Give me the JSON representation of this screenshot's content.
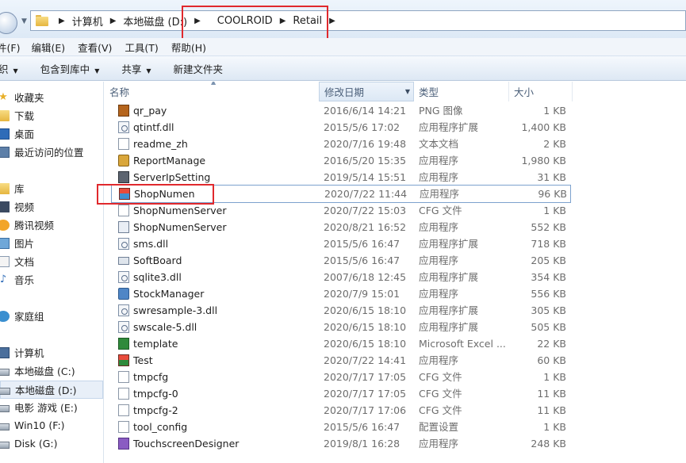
{
  "address_bar": {
    "breadcrumbs": [
      "计算机",
      "本地磁盘 (D:)",
      "COOLROID",
      "Retail"
    ]
  },
  "menubar": {
    "items": [
      "件(F)",
      "编辑(E)",
      "查看(V)",
      "工具(T)",
      "帮助(H)"
    ]
  },
  "toolbar": {
    "items": [
      "织",
      "包含到库中",
      "共享",
      "新建文件夹"
    ]
  },
  "navpane": {
    "items": [
      {
        "label": "收藏夹",
        "icon": "star-icon"
      },
      {
        "label": "下载",
        "icon": "folder-icon"
      },
      {
        "label": "桌面",
        "icon": "desktop-icon"
      },
      {
        "label": "最近访问的位置",
        "icon": "recent-icon"
      },
      {
        "label": "库",
        "icon": "library-icon"
      },
      {
        "label": "视频",
        "icon": "video-icon"
      },
      {
        "label": "腾讯视频",
        "icon": "qq-video-icon"
      },
      {
        "label": "图片",
        "icon": "picture-icon"
      },
      {
        "label": "文档",
        "icon": "document-icon"
      },
      {
        "label": "音乐",
        "icon": "music-icon"
      },
      {
        "label": "家庭组",
        "icon": "homegroup-icon"
      },
      {
        "label": "计算机",
        "icon": "computer-icon"
      },
      {
        "label": "本地磁盘 (C:)",
        "icon": "drive-icon"
      },
      {
        "label": "本地磁盘 (D:)",
        "icon": "drive-icon",
        "selected": true
      },
      {
        "label": "电影 游戏 (E:)",
        "icon": "drive-icon"
      },
      {
        "label": "Win10 (F:)",
        "icon": "drive-icon"
      },
      {
        "label": "Disk (G:)",
        "icon": "drive-icon"
      }
    ]
  },
  "filelist": {
    "columns": {
      "name": "名称",
      "date": "修改日期",
      "type": "类型",
      "size": "大小"
    },
    "rows": [
      {
        "name": "qr_pay",
        "date": "2016/6/14 14:21",
        "type": "PNG 图像",
        "size": "1 KB",
        "icon": "png-icon"
      },
      {
        "name": "qtintf.dll",
        "date": "2015/5/6 17:02",
        "type": "应用程序扩展",
        "size": "1,400 KB",
        "icon": "dll-icon"
      },
      {
        "name": "readme_zh",
        "date": "2020/7/16 19:48",
        "type": "文本文档",
        "size": "2 KB",
        "icon": "text-icon"
      },
      {
        "name": "ReportManage",
        "date": "2016/5/20 15:35",
        "type": "应用程序",
        "size": "1,980 KB",
        "icon": "app-icon"
      },
      {
        "name": "ServerIpSetting",
        "date": "2019/5/14 15:51",
        "type": "应用程序",
        "size": "31 KB",
        "icon": "app-icon"
      },
      {
        "name": "ShopNumen",
        "date": "2020/7/22 11:44",
        "type": "应用程序",
        "size": "96 KB",
        "icon": "shop-icon",
        "selected": true
      },
      {
        "name": "ShopNumenServer",
        "date": "2020/7/22 15:03",
        "type": "CFG 文件",
        "size": "1 KB",
        "icon": "cfg-icon"
      },
      {
        "name": "ShopNumenServer",
        "date": "2020/8/21 16:52",
        "type": "应用程序",
        "size": "552 KB",
        "icon": "window-icon"
      },
      {
        "name": "sms.dll",
        "date": "2015/5/6 16:47",
        "type": "应用程序扩展",
        "size": "718 KB",
        "icon": "dll-icon"
      },
      {
        "name": "SoftBoard",
        "date": "2015/5/6 16:47",
        "type": "应用程序",
        "size": "205 KB",
        "icon": "keyboard-icon"
      },
      {
        "name": "sqlite3.dll",
        "date": "2007/6/18 12:45",
        "type": "应用程序扩展",
        "size": "354 KB",
        "icon": "dll-icon"
      },
      {
        "name": "StockManager",
        "date": "2020/7/9 15:01",
        "type": "应用程序",
        "size": "556 KB",
        "icon": "stock-icon"
      },
      {
        "name": "swresample-3.dll",
        "date": "2020/6/15 18:10",
        "type": "应用程序扩展",
        "size": "305 KB",
        "icon": "dll-icon"
      },
      {
        "name": "swscale-5.dll",
        "date": "2020/6/15 18:10",
        "type": "应用程序扩展",
        "size": "505 KB",
        "icon": "dll-icon"
      },
      {
        "name": "template",
        "date": "2020/6/15 18:10",
        "type": "Microsoft Excel ...",
        "size": "22 KB",
        "icon": "excel-icon"
      },
      {
        "name": "Test",
        "date": "2020/7/22 14:41",
        "type": "应用程序",
        "size": "60 KB",
        "icon": "test-app-icon"
      },
      {
        "name": "tmpcfg",
        "date": "2020/7/17 17:05",
        "type": "CFG 文件",
        "size": "1 KB",
        "icon": "cfg-icon"
      },
      {
        "name": "tmpcfg-0",
        "date": "2020/7/17 17:05",
        "type": "CFG 文件",
        "size": "11 KB",
        "icon": "cfg-icon"
      },
      {
        "name": "tmpcfg-2",
        "date": "2020/7/17 17:06",
        "type": "CFG 文件",
        "size": "11 KB",
        "icon": "cfg-icon"
      },
      {
        "name": "tool_config",
        "date": "2015/5/6 16:47",
        "type": "配置设置",
        "size": "1 KB",
        "icon": "config-icon"
      },
      {
        "name": "TouchscreenDesigner",
        "date": "2019/8/1 16:28",
        "type": "应用程序",
        "size": "248 KB",
        "icon": "designer-icon"
      }
    ]
  }
}
